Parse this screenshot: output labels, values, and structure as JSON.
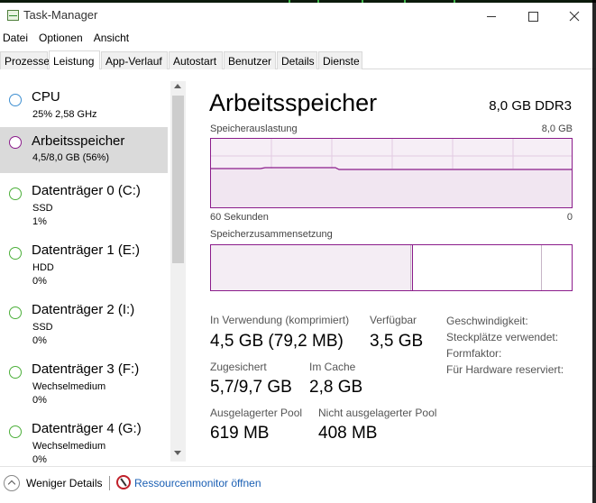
{
  "window": {
    "title": "Task-Manager",
    "accent_color": "#8b1c8b"
  },
  "menu": [
    "Datei",
    "Optionen",
    "Ansicht"
  ],
  "tabs": [
    {
      "label": "Prozesse"
    },
    {
      "label": "Leistung",
      "active": true
    },
    {
      "label": "App-Verlauf"
    },
    {
      "label": "Autostart"
    },
    {
      "label": "Benutzer"
    },
    {
      "label": "Details"
    },
    {
      "label": "Dienste"
    }
  ],
  "sidebar": {
    "items": [
      {
        "name": "CPU",
        "sub1": "25%  2,58 GHz",
        "sub2": "",
        "dot_color": "#3e8fd1"
      },
      {
        "name": "Arbeitsspeicher",
        "sub1": "4,5/8,0 GB (56%)",
        "sub2": "",
        "dot_color": "#8b1c8b",
        "selected": true
      },
      {
        "name": "Datenträger 0 (C:)",
        "sub1": "SSD",
        "sub2": "1%",
        "dot_color": "#4caf3a"
      },
      {
        "name": "Datenträger 1 (E:)",
        "sub1": "HDD",
        "sub2": "0%",
        "dot_color": "#4caf3a"
      },
      {
        "name": "Datenträger 2 (I:)",
        "sub1": "SSD",
        "sub2": "0%",
        "dot_color": "#4caf3a"
      },
      {
        "name": "Datenträger 3 (F:)",
        "sub1": "Wechselmedium",
        "sub2": "0%",
        "dot_color": "#4caf3a"
      },
      {
        "name": "Datenträger 4 (G:)",
        "sub1": "Wechselmedium",
        "sub2": "0%",
        "dot_color": "#4caf3a"
      }
    ]
  },
  "main": {
    "title": "Arbeitsspeicher",
    "spec": "8,0 GB DDR3",
    "usage_label": "Speicherauslastung",
    "usage_max": "8,0 GB",
    "time_label": "60 Sekunden",
    "time_end": "0",
    "composition_label": "Speicherzusammensetzung",
    "composition_in_use_fraction": 0.56,
    "stats": {
      "in_use_label": "In Verwendung (komprimiert)",
      "in_use_value": "4,5 GB (79,2 MB)",
      "available_label": "Verfügbar",
      "available_value": "3,5 GB",
      "committed_label": "Zugesichert",
      "committed_value": "5,7/9,7 GB",
      "cached_label": "Im Cache",
      "cached_value": "2,8 GB",
      "paged_label": "Ausgelagerter Pool",
      "paged_value": "619 MB",
      "nonpaged_label": "Nicht ausgelagerter Pool",
      "nonpaged_value": "408 MB"
    },
    "specs": {
      "speed_label": "Geschwindigkeit:",
      "slots_label": "Steckplätze verwendet:",
      "form_label": "Formfaktor:",
      "reserved_label": "Für Hardware reserviert:"
    }
  },
  "footer": {
    "fewer_details": "Weniger Details",
    "resource_monitor": "Ressourcenmonitor öffnen"
  }
}
